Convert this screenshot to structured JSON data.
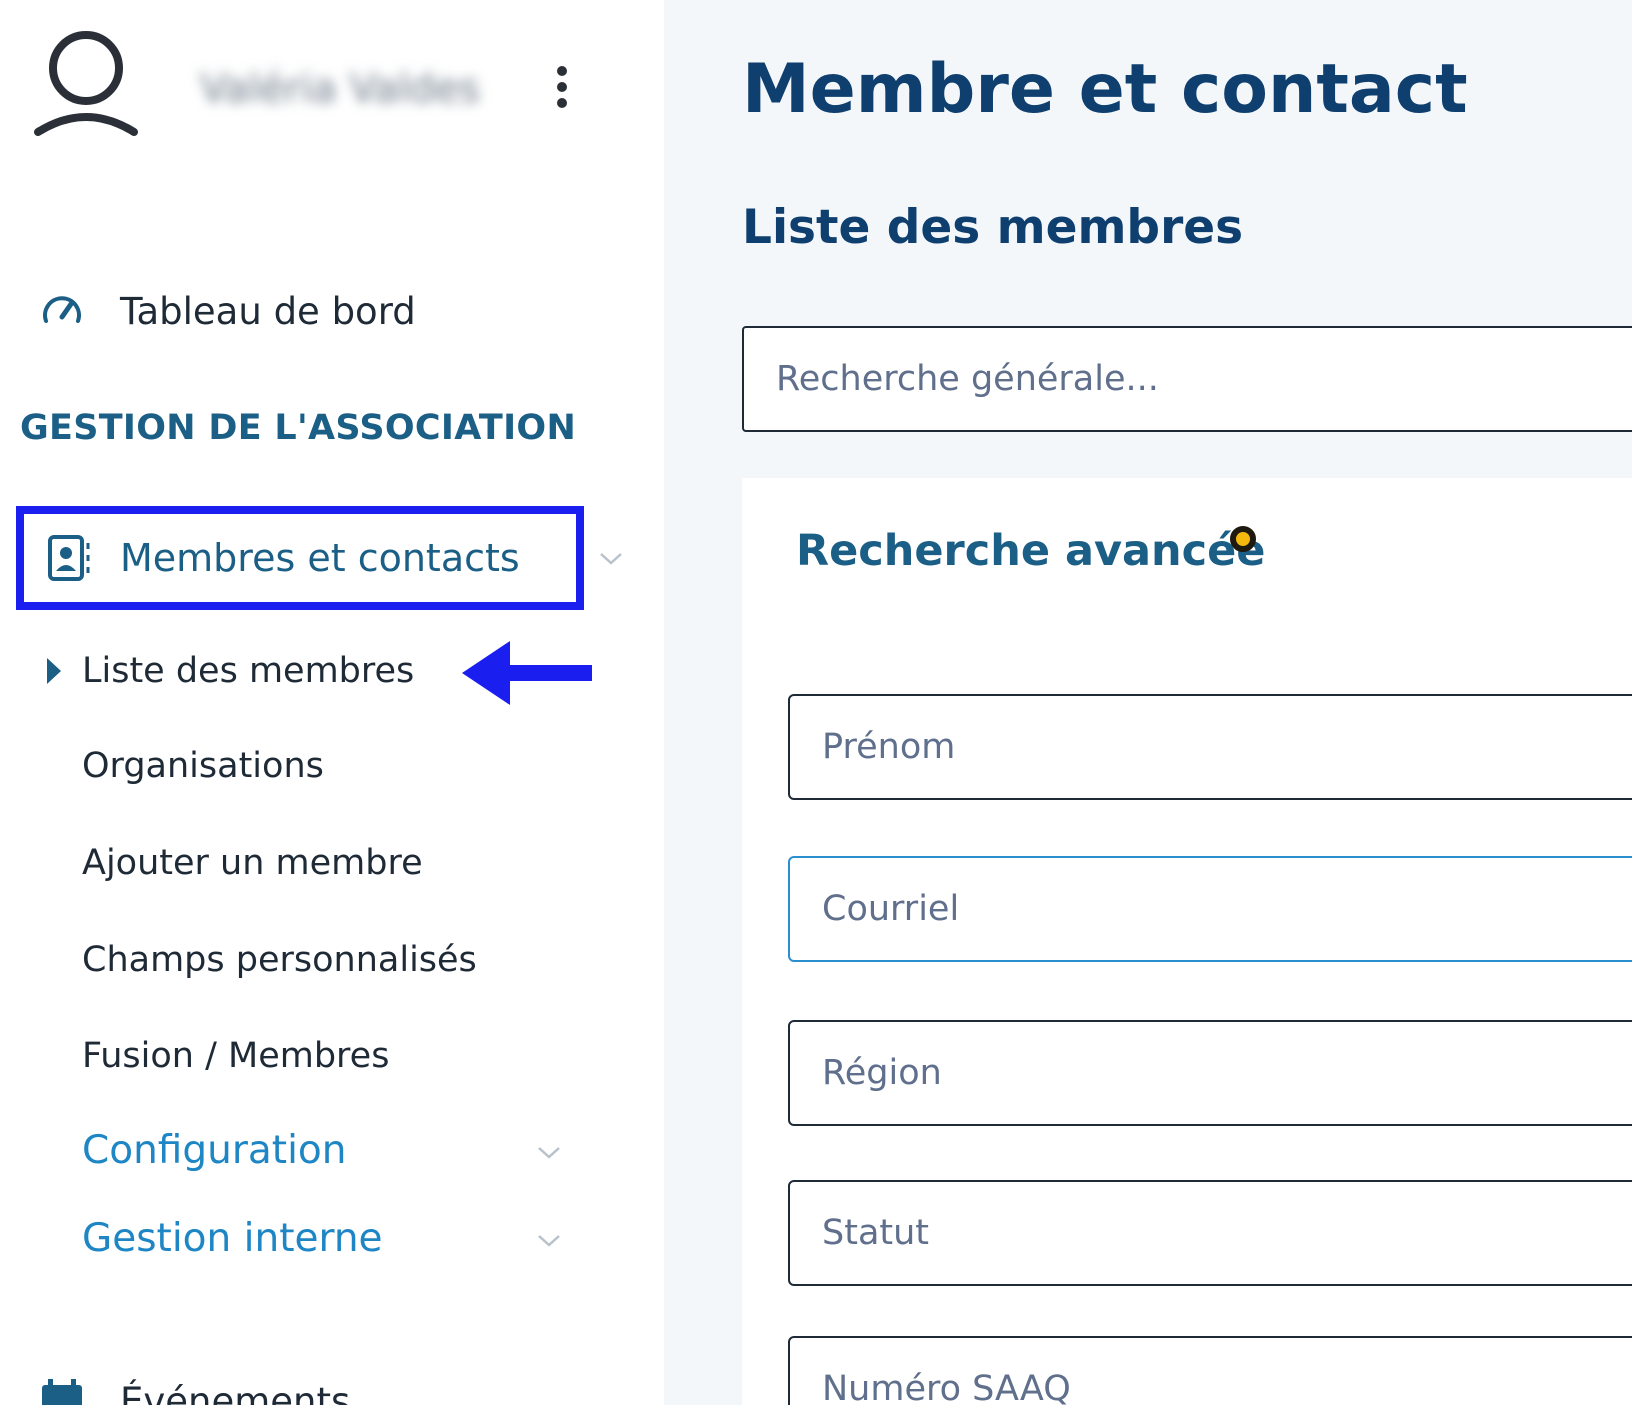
{
  "user": {
    "name": "Valéria Valdes"
  },
  "sidebar": {
    "dashboard_label": "Tableau de bord",
    "section_title": "GESTION DE L'ASSOCIATION",
    "members_label": "Membres et contacts",
    "sub_items": [
      "Liste des membres",
      "Organisations",
      "Ajouter un membre",
      "Champs personnalisés",
      "Fusion / Membres"
    ],
    "groups": [
      "Configuration",
      "Gestion interne"
    ],
    "events_label": "Événements"
  },
  "main": {
    "page_title": "Membre et contact",
    "sub_title": "Liste des membres",
    "general_search_placeholder": "Recherche générale...",
    "advanced_title": "Recherche avancée",
    "fields": [
      "Prénom",
      "Courriel",
      "Région",
      "Statut",
      "Numéro SAAQ"
    ]
  },
  "colors": {
    "accent": "#1b5e86",
    "link": "#1e86c4",
    "highlight_box": "#1a1ff0",
    "status_dot": "#f5b80d"
  },
  "icons": [
    "user-icon",
    "kebab-menu-icon",
    "dashboard-gauge-icon",
    "contact-card-icon",
    "caret-right-icon",
    "chevron-down-icon",
    "calendar-icon"
  ]
}
